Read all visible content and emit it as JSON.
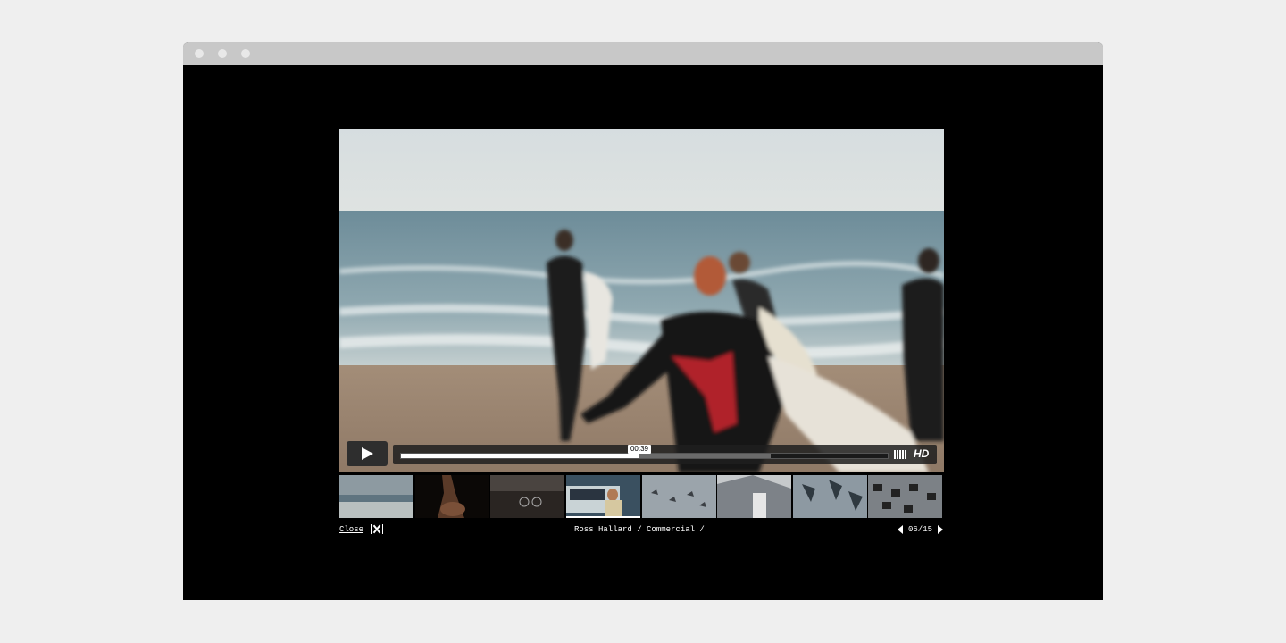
{
  "player": {
    "current_time": "00:39",
    "quality_badge": "HD",
    "progress_played": 0.49,
    "progress_buffered": 0.76
  },
  "thumbnails": [
    {
      "name": "thumb-beach-shore"
    },
    {
      "name": "thumb-dancer"
    },
    {
      "name": "thumb-cyclist"
    },
    {
      "name": "thumb-surfers-van",
      "active": true
    },
    {
      "name": "thumb-birds"
    },
    {
      "name": "thumb-building"
    },
    {
      "name": "thumb-robot-arms"
    },
    {
      "name": "thumb-machines"
    }
  ],
  "footer": {
    "close_label": "Close",
    "caption": "Ross Hallard / Commercial /",
    "counter": "06/15"
  }
}
